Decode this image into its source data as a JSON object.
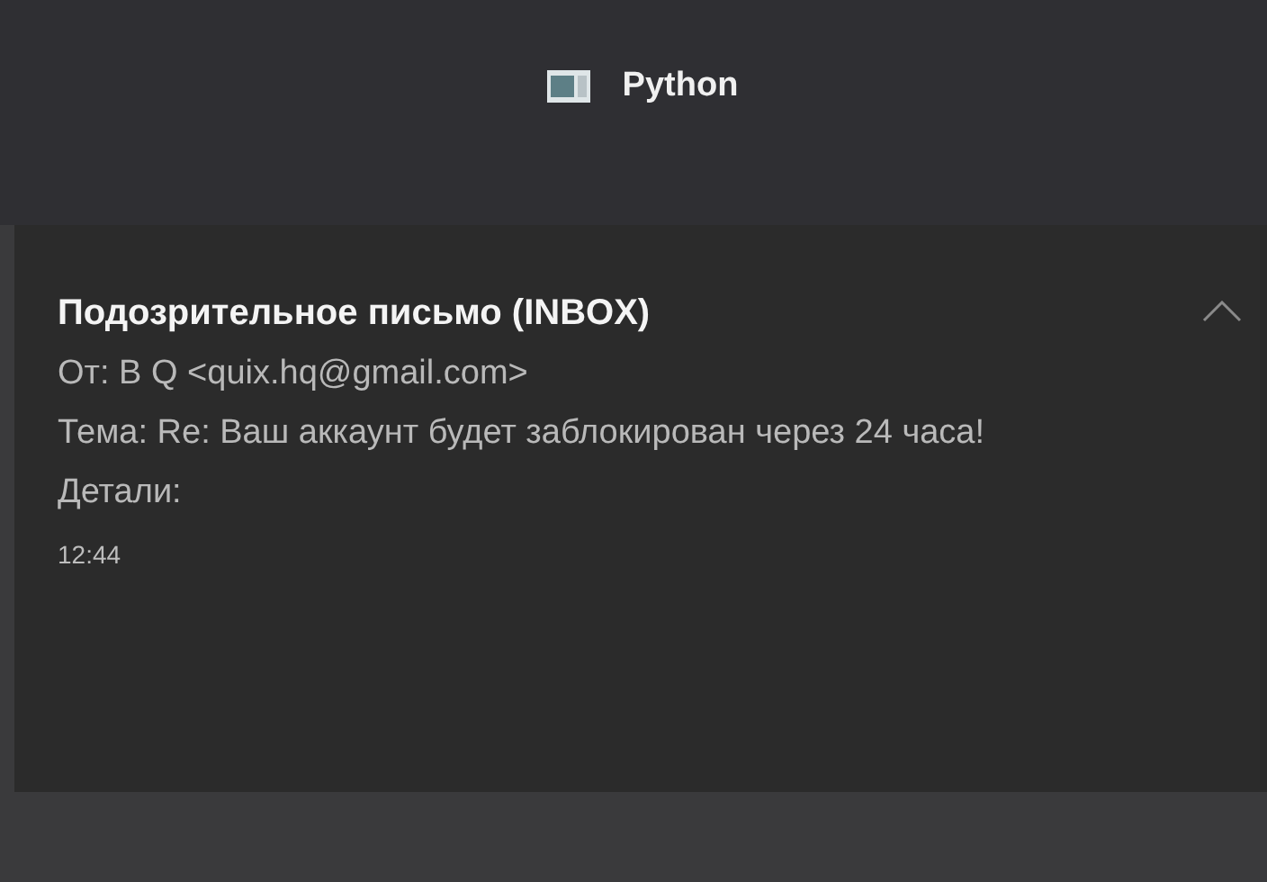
{
  "header": {
    "app_name": "Python"
  },
  "notification": {
    "title": "Подозрительное письмо (INBOX)",
    "lines": [
      "От: B Q <quix.hq@gmail.com>",
      "Тема: Re: Ваш аккаунт будет заблокирован через 24 часа!",
      "Детали:"
    ],
    "time": "12:44",
    "expanded": true
  }
}
